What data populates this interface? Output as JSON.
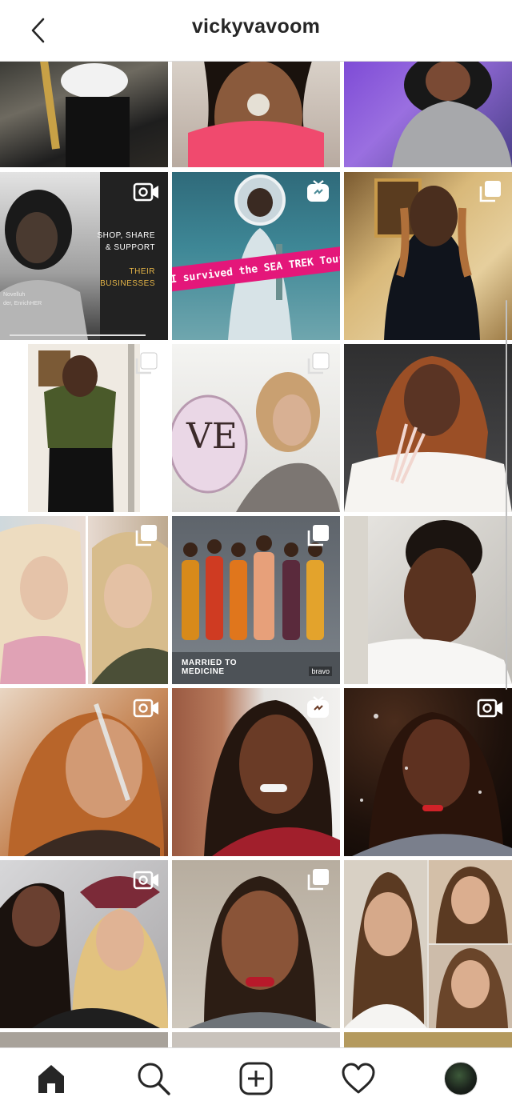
{
  "header": {
    "title": "vickyvavoom",
    "back_icon": "chevron-left-icon"
  },
  "colors": {
    "text": "#262626",
    "divider": "#dbdbdb",
    "banner_pink": "#e4177a",
    "promo_gold": "#e6b648"
  },
  "grid": {
    "tiles": [
      {
        "name": "post-1",
        "overlay": "none"
      },
      {
        "name": "post-2",
        "overlay": "none"
      },
      {
        "name": "post-3",
        "overlay": "none"
      },
      {
        "name": "post-4",
        "overlay": "video-icon",
        "promo_line1": "SHOP, SHARE",
        "promo_line2": "& SUPPORT",
        "promo_line3": "THEIR",
        "promo_line4": "BUSINESSES",
        "caption_line1": "Novelluh",
        "caption_line2": "der, EnrichHER"
      },
      {
        "name": "post-5",
        "overlay": "igtv-icon",
        "banner": "I survived the SEA TREK Tour"
      },
      {
        "name": "post-6",
        "overlay": "carousel-icon"
      },
      {
        "name": "post-7",
        "overlay": "carousel-icon"
      },
      {
        "name": "post-8",
        "overlay": "carousel-icon"
      },
      {
        "name": "post-9",
        "overlay": "none"
      },
      {
        "name": "post-10",
        "overlay": "carousel-icon"
      },
      {
        "name": "post-11",
        "overlay": "carousel-icon",
        "brand_line1": "MARRIED TO",
        "brand_line2": "MEDICINE",
        "network": "bravo"
      },
      {
        "name": "post-12",
        "overlay": "none"
      },
      {
        "name": "post-13",
        "overlay": "video-icon"
      },
      {
        "name": "post-14",
        "overlay": "igtv-icon"
      },
      {
        "name": "post-15",
        "overlay": "video-icon"
      },
      {
        "name": "post-16",
        "overlay": "video-icon"
      },
      {
        "name": "post-17",
        "overlay": "carousel-icon"
      },
      {
        "name": "post-18",
        "overlay": "none"
      }
    ]
  },
  "tab_bar": {
    "tabs": [
      "home-icon",
      "search-icon",
      "add-post-icon",
      "heart-icon",
      "profile-avatar"
    ]
  }
}
